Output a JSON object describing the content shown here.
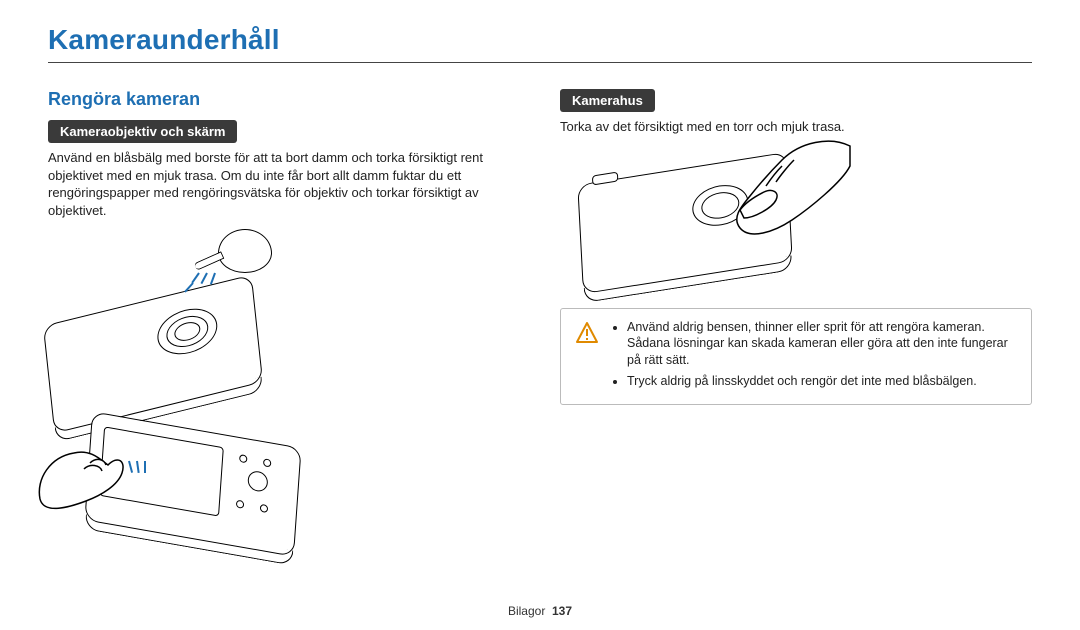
{
  "title": "Kameraunderhåll",
  "accent_color": "#1e6fb3",
  "left": {
    "section_heading": "Rengöra kameran",
    "subhead": "Kameraobjektiv och skärm",
    "body": "Använd en blåsbälg med borste för att ta bort damm och torka försiktigt rent objektivet med en mjuk trasa. Om du inte får bort allt damm fuktar du ett rengöringspapper med rengöringsvätska för objektiv och torkar försiktigt av objektivet."
  },
  "right": {
    "subhead": "Kamerahus",
    "body": "Torka av det försiktigt med en torr och mjuk trasa.",
    "warning": {
      "items": [
        "Använd aldrig bensen, thinner eller sprit för att rengöra kameran. Sådana lösningar kan skada kameran eller göra att den inte fungerar på rätt sätt.",
        "Tryck aldrig på linsskyddet och rengör det inte med blåsbälgen."
      ]
    }
  },
  "footer": {
    "section": "Bilagor",
    "page": "137"
  }
}
